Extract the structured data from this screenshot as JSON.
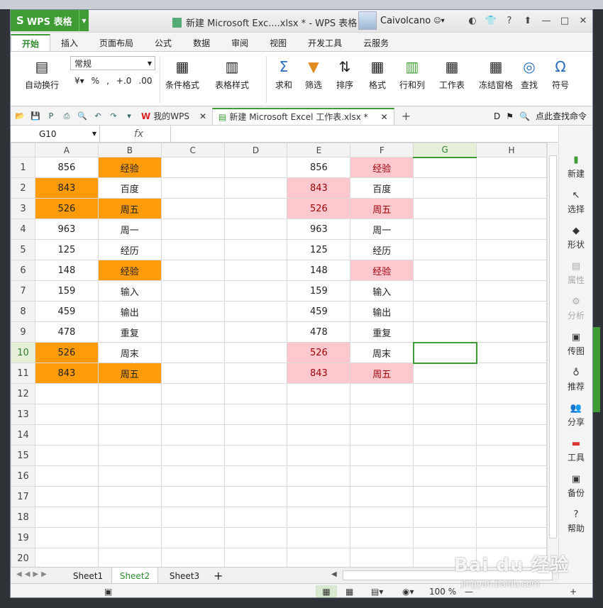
{
  "app": {
    "title": "WPS 表格",
    "doc_title": "新建 Microsoft Exc....xlsx * - WPS 表格",
    "user": "Caivolcano"
  },
  "ribbon_tabs": [
    "开始",
    "插入",
    "页面布局",
    "公式",
    "数据",
    "审阅",
    "视图",
    "开发工具",
    "云服务"
  ],
  "ribbon": {
    "autowrap": "自动换行",
    "numfmt": "常规",
    "percent": "%",
    "cond": "条件格式",
    "tablestyle": "表格样式",
    "sum": "求和",
    "filter": "筛选",
    "sort": "排序",
    "format": "格式",
    "rowcol": "行和列",
    "sheet": "工作表",
    "freeze": "冻结窗格",
    "find": "查找",
    "symbol": "符号"
  },
  "doc_tabs": {
    "mywps": "我的WPS",
    "file": "新建 Microsoft Excel 工作表.xlsx *"
  },
  "search_cmd": "点此查找命令",
  "namebox": "G10",
  "fx": "fx",
  "columns": [
    "A",
    "B",
    "C",
    "D",
    "E",
    "F",
    "G",
    "H"
  ],
  "rows": [
    {
      "n": "1",
      "a": "856",
      "b": "经验",
      "e": "856",
      "f": "经验"
    },
    {
      "n": "2",
      "a": "843",
      "b": "百度",
      "e": "843",
      "f": "百度"
    },
    {
      "n": "3",
      "a": "526",
      "b": "周五",
      "e": "526",
      "f": "周五"
    },
    {
      "n": "4",
      "a": "963",
      "b": "周一",
      "e": "963",
      "f": "周一"
    },
    {
      "n": "5",
      "a": "125",
      "b": "经历",
      "e": "125",
      "f": "经历"
    },
    {
      "n": "6",
      "a": "148",
      "b": "经验",
      "e": "148",
      "f": "经验"
    },
    {
      "n": "7",
      "a": "159",
      "b": "输入",
      "e": "159",
      "f": "输入"
    },
    {
      "n": "8",
      "a": "459",
      "b": "输出",
      "e": "459",
      "f": "输出"
    },
    {
      "n": "9",
      "a": "478",
      "b": "重复",
      "e": "478",
      "f": "重复"
    },
    {
      "n": "10",
      "a": "526",
      "b": "周末",
      "e": "526",
      "f": "周末"
    },
    {
      "n": "11",
      "a": "843",
      "b": "周五",
      "e": "843",
      "f": "周五"
    },
    {
      "n": "12"
    },
    {
      "n": "13"
    },
    {
      "n": "14"
    },
    {
      "n": "15"
    },
    {
      "n": "16"
    },
    {
      "n": "17"
    },
    {
      "n": "18"
    },
    {
      "n": "19"
    },
    {
      "n": "20"
    }
  ],
  "highlight": {
    "orange_a": [
      2,
      3,
      10,
      11
    ],
    "orange_b": [
      1,
      3,
      6,
      11
    ],
    "pink_e": [
      2,
      3,
      10,
      11
    ],
    "pink_f": [
      1,
      3,
      6,
      11
    ],
    "orange": "#ff9a08",
    "pink": "#ffc8ce",
    "pink_text": "#9c0006",
    "accent": "#3f9c35"
  },
  "right_panel": [
    "新建",
    "选择",
    "形状",
    "属性",
    "分析",
    "传图",
    "推荐",
    "分享",
    "工具",
    "备份",
    "帮助"
  ],
  "sheets": [
    "Sheet1",
    "Sheet2",
    "Sheet3"
  ],
  "active_sheet": "Sheet2",
  "zoom": "100 %",
  "watermark": {
    "main": "Bai du 经验",
    "sub": "jingyan.baidu.com"
  }
}
